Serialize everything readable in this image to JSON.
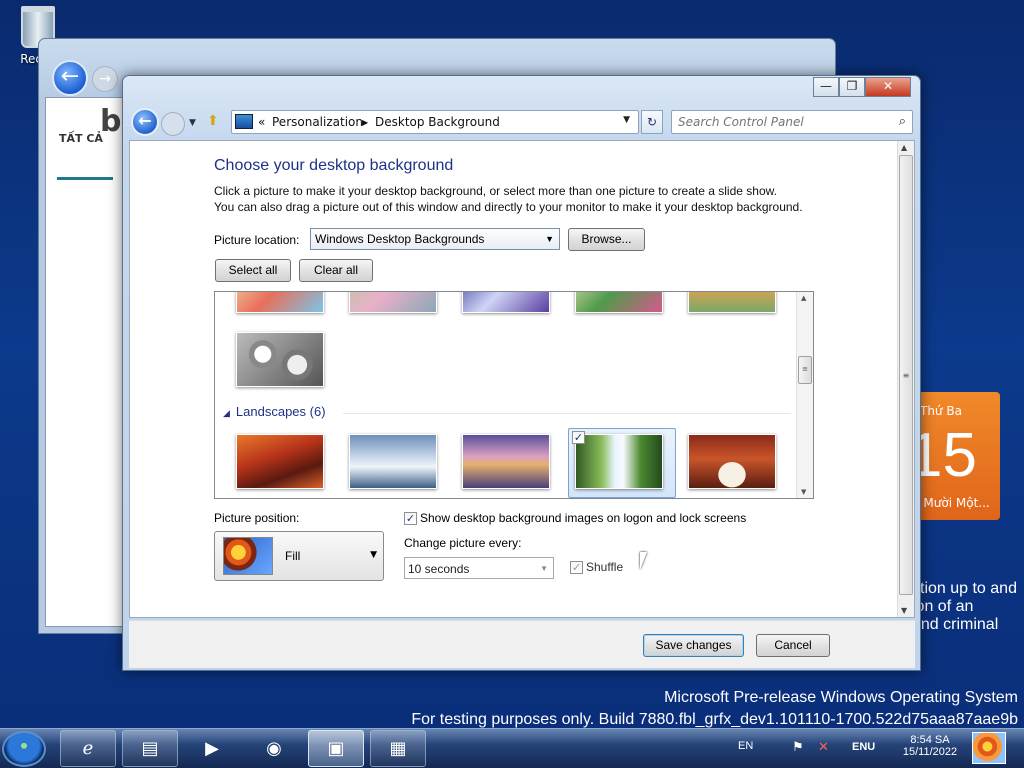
{
  "desktop": {
    "recycle_bin_label": "Recyc",
    "watermark_line1": "Microsoft Pre-release Windows Operating System",
    "watermark_line2": "For testing purposes only. Build 7880.fbl_grfx_dev1.101110-1700.522d75aaa87aae9b",
    "calendar_gadget": {
      "day_of_week": "Thứ Ba",
      "day_number": "15",
      "subtitle": "g Mười Một..."
    },
    "news_text": [
      "ction up to and",
      "ion of an",
      "and criminal"
    ]
  },
  "background_window": {
    "tab_label": "TẤT CẢ",
    "bing_glyph": "b",
    "caption_buttons": [
      "—",
      "❐",
      "✕"
    ]
  },
  "window": {
    "caption_buttons": {
      "minimize": "—",
      "maximize": "❐",
      "close": "✕"
    },
    "breadcrumb": {
      "prefix": "«",
      "items": [
        "Personalization",
        "Desktop Background"
      ],
      "separator": "▶"
    },
    "search_placeholder": "Search Control Panel",
    "heading": "Choose your desktop background",
    "description_line1": "Click a picture to make it your desktop background, or select more than one picture to create a slide show.",
    "description_line2": "You can also drag a picture out of this window and directly to your monitor to make it your desktop background.",
    "picture_location_label": "Picture location:",
    "picture_location_value": "Windows Desktop Backgrounds",
    "browse_button": "Browse...",
    "select_all_button": "Select all",
    "clear_all_button": "Clear all",
    "group_header": "Landscapes (6)",
    "group_collapse_glyph": "◢",
    "picture_position_label": "Picture position:",
    "picture_position_value": "Fill",
    "show_on_logon_label": "Show desktop background images on logon and lock screens",
    "show_on_logon_checked": true,
    "change_every_label": "Change picture every:",
    "change_every_value": "10 seconds",
    "shuffle_label": "Shuffle",
    "shuffle_checked": true,
    "save_button": "Save changes",
    "cancel_button": "Cancel"
  },
  "taskbar": {
    "language": "EN",
    "input": "ENU",
    "time": "8:54 SA",
    "date": "15/11/2022",
    "pinned_icons": [
      "internet-explorer-icon",
      "windows-explorer-icon",
      "media-player-icon",
      "raccoon-app-icon",
      "control-panel-icon",
      "gadgets-icon"
    ]
  },
  "colors": {
    "heading_blue": "#1e3287",
    "calendar_orange": "#e8701f",
    "selection_blue": "#7da2ce"
  }
}
